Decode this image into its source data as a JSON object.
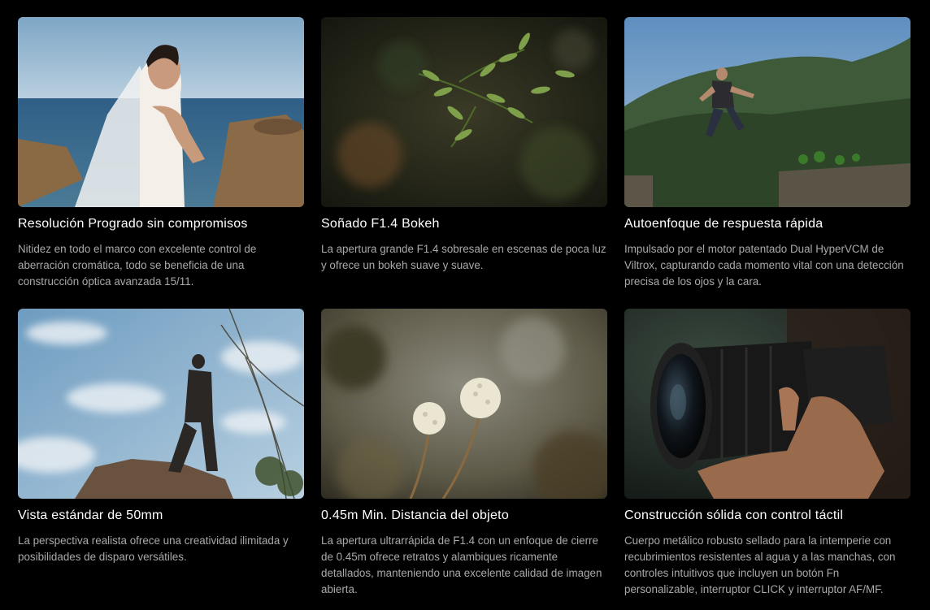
{
  "features": [
    {
      "title": "Resolución Progradо sin compromisos",
      "description": "Nitidez en todo el marco con excelente control de aberración cromática, todo se beneficia de una construcción óptica avanzada 15/11.",
      "image": "bride-by-sea-photo"
    },
    {
      "title": "Soñado F1.4 Bokeh",
      "description": "La apertura grande F1.4 sobresale en escenas de poca luz y ofrece un bokeh suave y suave.",
      "image": "olive-branch-bokeh-photo"
    },
    {
      "title": "Autoenfoque de respuesta rápida",
      "description": "Impulsado por el motor patentado Dual HyperVCM de Viltrox, capturando cada momento vital con una detección precisa de los ojos y la cara.",
      "image": "man-jumping-mountain-photo"
    },
    {
      "title": "Vista estándar de 50mm",
      "description": "La perspectiva realista ofrece una creatividad ilimitada y posibilidades de disparo versátiles.",
      "image": "man-on-rock-sky-photo"
    },
    {
      "title": "0.45m Min. Distancia del objeto",
      "description": "La apertura ultrarrápida de F1.4 con un enfoque de cierre de 0.45m ofrece retratos y alambiques ricamente detallados, manteniendo una excelente calidad de imagen abierta.",
      "image": "white-flowers-closeup-photo"
    },
    {
      "title": "Construcción sólida con control táctil",
      "description": "Cuerpo metálico robusto sellado para la intemperie con recubrimientos resistentes al agua y a las manchas, con controles intuitivos que incluyen un botón Fn personalizable, interruptor CLICK y interruptor AF/MF.",
      "image": "hand-holding-camera-lens-photo"
    }
  ]
}
